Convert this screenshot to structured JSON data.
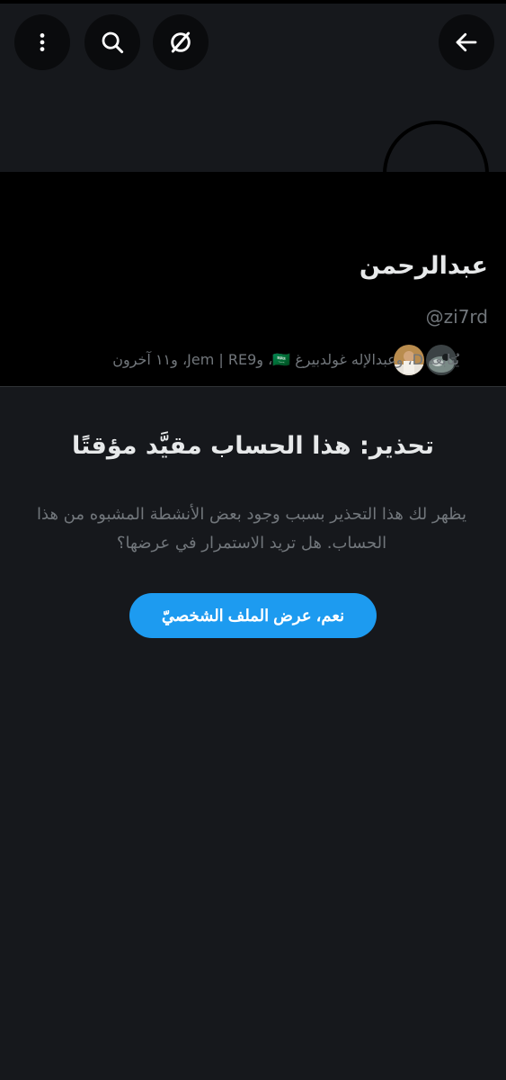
{
  "header": {
    "back_icon": "arrow-left-icon",
    "hide_icon": "eye-slash-icon",
    "search_icon": "search-icon",
    "more_icon": "more-vertical-icon"
  },
  "profile": {
    "display_name": "عبدالرحمن",
    "handle": "@zi7rd",
    "followed_by_text": "يُتابعه D، وعبدالإله غولدبيرغ 🇸🇦، وJem | RE9، و١١ آخرون"
  },
  "warning": {
    "title": "تحذير: هذا الحساب مقيَّد مؤقتًا",
    "body": "يظهر لك هذا التحذير بسبب وجود بعض الأنشطة المشبوه من هذا الحساب. هل تريد الاستمرار في عرضها؟",
    "confirm_label": "نعم، عرض الملف الشخصيّ"
  },
  "colors": {
    "background": "#16181c",
    "panel": "#000000",
    "accent": "#1d9bf0",
    "primary_text": "#e7e9ea",
    "secondary_text": "#71767b"
  }
}
